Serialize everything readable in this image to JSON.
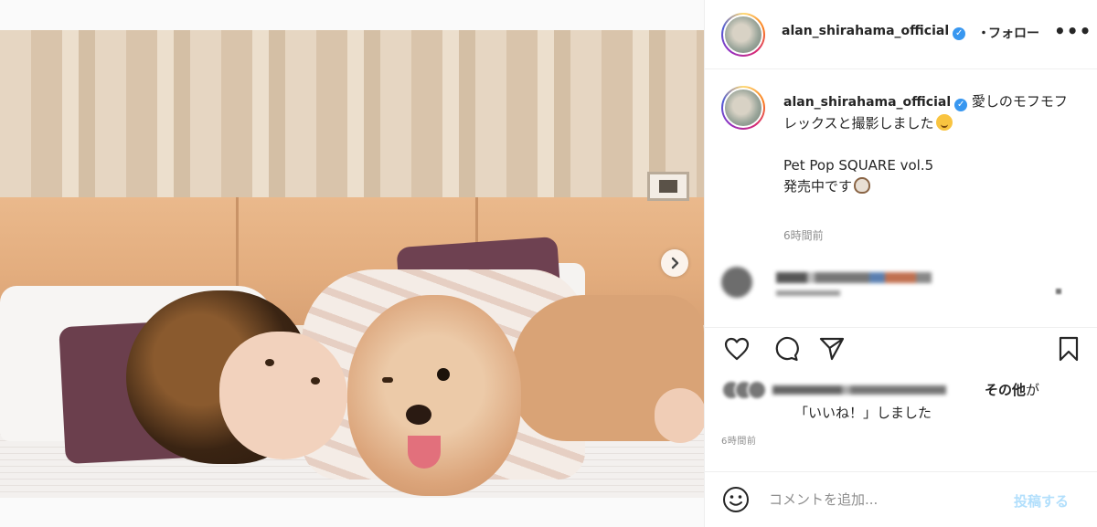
{
  "header": {
    "username": "alan_shirahama_official",
    "dot": "・",
    "follow_label": "フォロー",
    "more": "•••"
  },
  "caption": {
    "username": "alan_shirahama_official",
    "lines": [
      "愛しのモフモフ",
      "レックスと撮影しました",
      "",
      "Pet Pop SQUARE vol.5",
      "発売中です"
    ],
    "time": "6時間前"
  },
  "likes": {
    "others": "その他",
    "ga": "が",
    "liked": "「いいね！」しました"
  },
  "post_time": "6時間前",
  "comment": {
    "placeholder": "コメントを追加...",
    "post_label": "投稿する"
  },
  "colors": {
    "verified": "#3897f0",
    "post_button_disabled": "#b2dffc",
    "secondary_text": "#8e8e8e"
  },
  "icons": {
    "carousel": "chevron-right-icon",
    "like": "heart-icon",
    "comment": "comment-bubble-icon",
    "share": "paper-plane-icon",
    "save": "bookmark-icon",
    "emoji": "smiley-icon"
  }
}
